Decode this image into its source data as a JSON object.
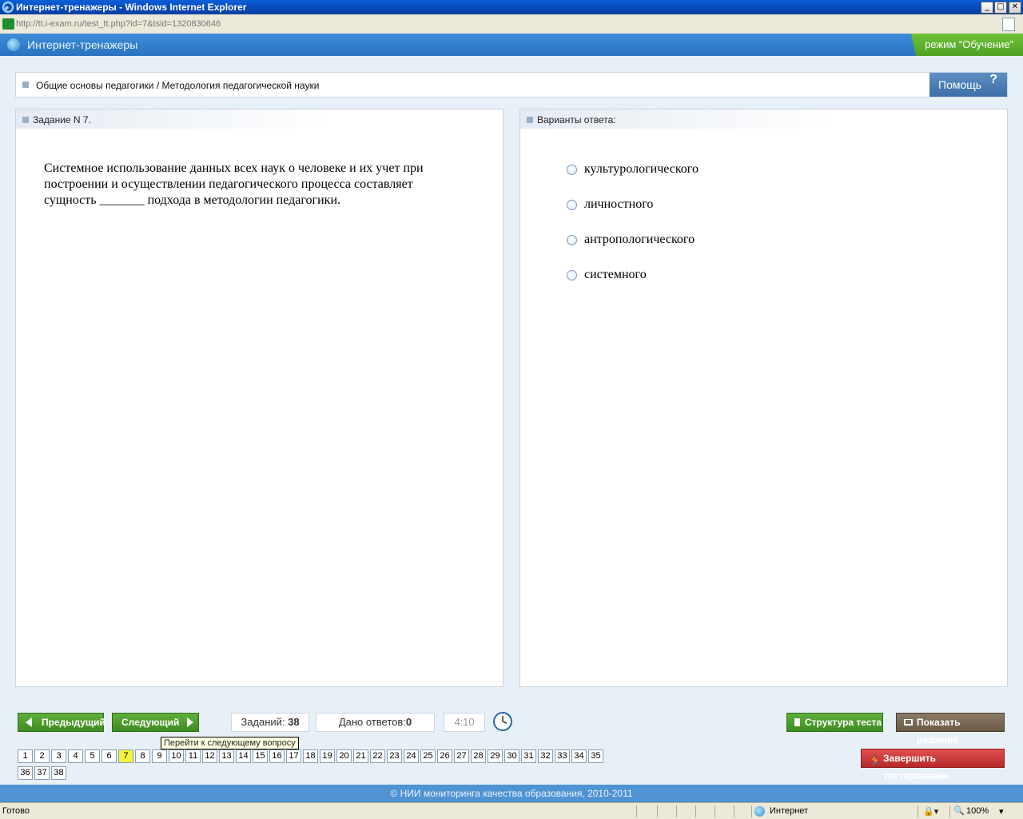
{
  "window": {
    "title": "Интернет-тренажеры - Windows Internet Explorer",
    "minimize": "_",
    "maximize": "□",
    "close": "✕"
  },
  "address": {
    "url": "http://tt.i-exam.ru/test_tt.php?id=7&tsid=1320830646"
  },
  "app": {
    "title": "Интернет-тренажеры",
    "mode": "режим “Обучение”"
  },
  "breadcrumb": "Общие основы педагогики / Методология педагогической науки",
  "help": {
    "label": "Помощь",
    "icon": "?"
  },
  "question": {
    "header": "Задание N 7.",
    "text": "Системное использование данных всех наук о человеке и их учет при построении и осуществлении педагогического процесса составляет сущность _______ подхода в методологии педагогики."
  },
  "answers": {
    "header": "Варианты ответа:",
    "options": [
      "культурологического",
      "личностного",
      "антропологического",
      "системного"
    ]
  },
  "toolbar": {
    "prev": "Предыдущий",
    "next": "Следующий",
    "tasks_label": "Заданий:",
    "tasks_value": "38",
    "answered_label": "Дано ответов:",
    "answered_value": "0",
    "timer": "4:10",
    "tooltip": "Перейти к следующему вопросу",
    "structure": "Структура теста",
    "show_solution": "Показать решение",
    "finish": "Завершить тестирование"
  },
  "pagination": {
    "current": "7",
    "row1": [
      "1",
      "2",
      "3",
      "4",
      "5",
      "6",
      "7",
      "8",
      "9",
      "10",
      "11",
      "12",
      "13",
      "14",
      "15",
      "16",
      "17",
      "18",
      "19",
      "20",
      "21",
      "22",
      "23",
      "24",
      "25",
      "26",
      "27",
      "28",
      "29",
      "30",
      "31",
      "32",
      "33",
      "34",
      "35"
    ],
    "row2": [
      "36",
      "37",
      "38"
    ]
  },
  "footer": "© НИИ мониторинга качества образования, 2010-2011",
  "status": {
    "text": "Готово",
    "zone": "Интернет",
    "zoom": "100%"
  }
}
